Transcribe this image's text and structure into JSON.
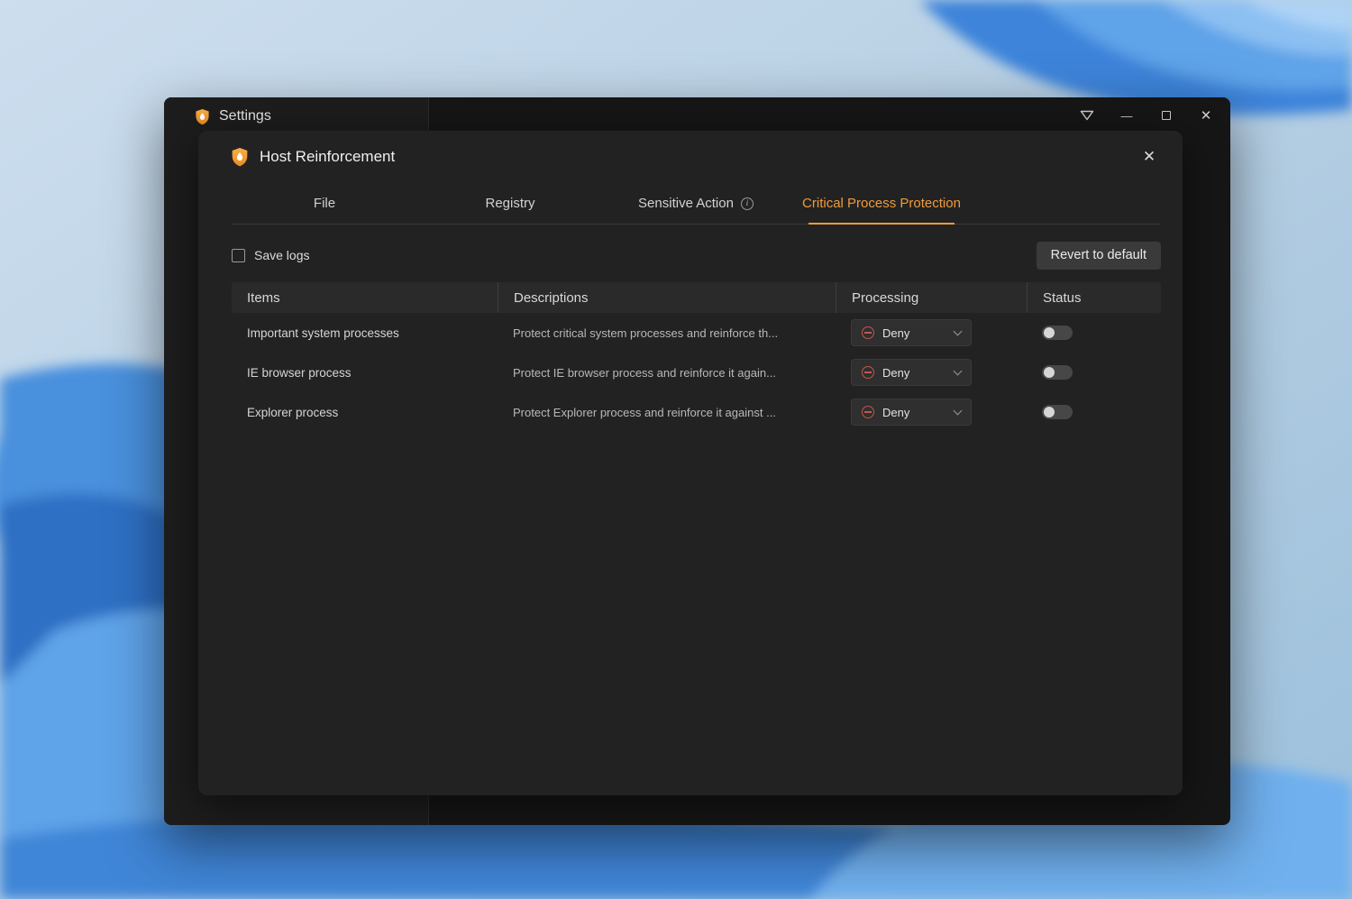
{
  "window": {
    "title": "Settings",
    "controls": {
      "minimize_glyph": "—",
      "close_glyph": "✕"
    }
  },
  "dialog": {
    "title": "Host Reinforcement",
    "close_glyph": "✕",
    "tabs": [
      {
        "label": "File",
        "active": false
      },
      {
        "label": "Registry",
        "active": false
      },
      {
        "label": "Sensitive Action",
        "active": false,
        "has_info_icon": true
      },
      {
        "label": "Critical Process Protection",
        "active": true
      }
    ],
    "save_logs": {
      "label": "Save logs",
      "checked": false
    },
    "revert_button_label": "Revert to default",
    "table": {
      "headers": [
        "Items",
        "Descriptions",
        "Processing",
        "Status"
      ],
      "rows": [
        {
          "item": "Important system processes",
          "description": "Protect critical system processes and reinforce th...",
          "processing": "Deny",
          "enabled": false
        },
        {
          "item": "IE browser process",
          "description": "Protect IE browser process and reinforce it again...",
          "processing": "Deny",
          "enabled": false
        },
        {
          "item": "Explorer process",
          "description": "Protect Explorer process and reinforce it against ...",
          "processing": "Deny",
          "enabled": false
        }
      ]
    }
  },
  "glyphs": {
    "info": "i"
  },
  "colors": {
    "accent_orange": "#f09a3c",
    "deny_red": "#c2574f",
    "dialog_bg": "#222222",
    "window_bg": "#161616"
  },
  "icons": {
    "app_icon": "shield-flame-icon",
    "titlebar_extra": "theme-skin-icon",
    "processing": "circle-minus-icon",
    "dropdown": "chevron-down-icon"
  }
}
